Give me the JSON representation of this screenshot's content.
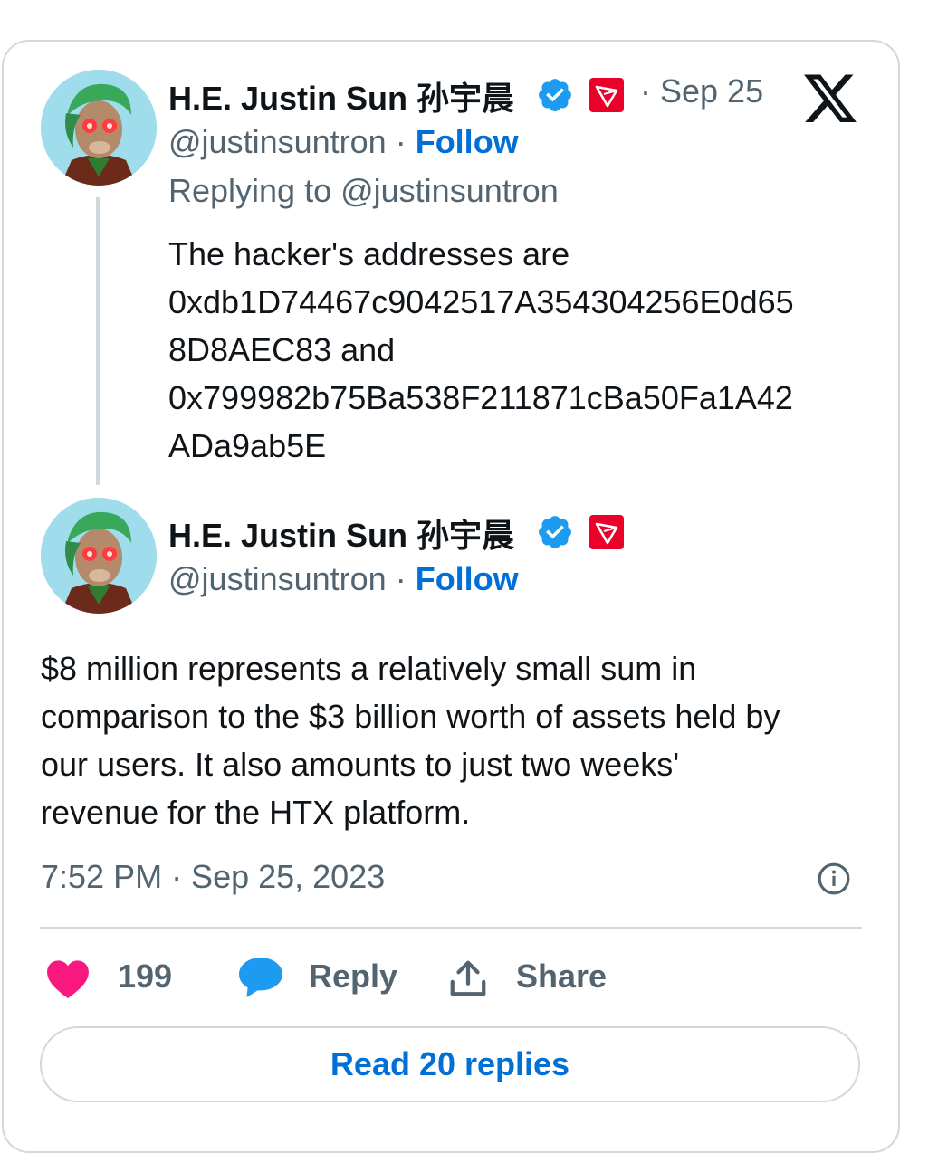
{
  "reply_tweet": {
    "author_name": "H.E. Justin Sun 孙宇晨",
    "handle": "@justinsuntron",
    "separator": "·",
    "follow_label": "Follow",
    "date": "· Sep 25",
    "replying_to": "Replying to @justinsuntron",
    "text_lines": [
      "The hacker's addresses are",
      "0xdb1D74467c9042517A354304256E0d65",
      "8D8AEC83 and",
      "0x799982b75Ba538F211871cBa50Fa1A42",
      "ADa9ab5E"
    ]
  },
  "main_tweet": {
    "author_name": "H.E. Justin Sun 孙宇晨",
    "handle": "@justinsuntron",
    "separator": "·",
    "follow_label": "Follow",
    "text_lines": [
      "$8 million represents a relatively small sum in",
      "comparison to the $3 billion worth of assets held by",
      "our users. It also amounts to just two weeks'",
      "revenue for the HTX platform."
    ],
    "timestamp": "7:52 PM · Sep 25, 2023"
  },
  "actions": {
    "like_count": "199",
    "reply_label": "Reply",
    "share_label": "Share"
  },
  "read_replies_label": "Read 20 replies",
  "icons": {
    "platform_logo": "x-logo-icon",
    "verified": "verified-badge-icon",
    "tron": "tron-logo-icon",
    "info": "info-icon",
    "like": "heart-icon",
    "reply": "speech-bubble-icon",
    "share": "share-upload-icon"
  },
  "colors": {
    "link_blue": "#006fd6",
    "verified_blue": "#1d9bf0",
    "heart_pink": "#f91880",
    "tron_red": "#eb0029",
    "secondary_text": "#536471",
    "border": "#cfd9de"
  }
}
